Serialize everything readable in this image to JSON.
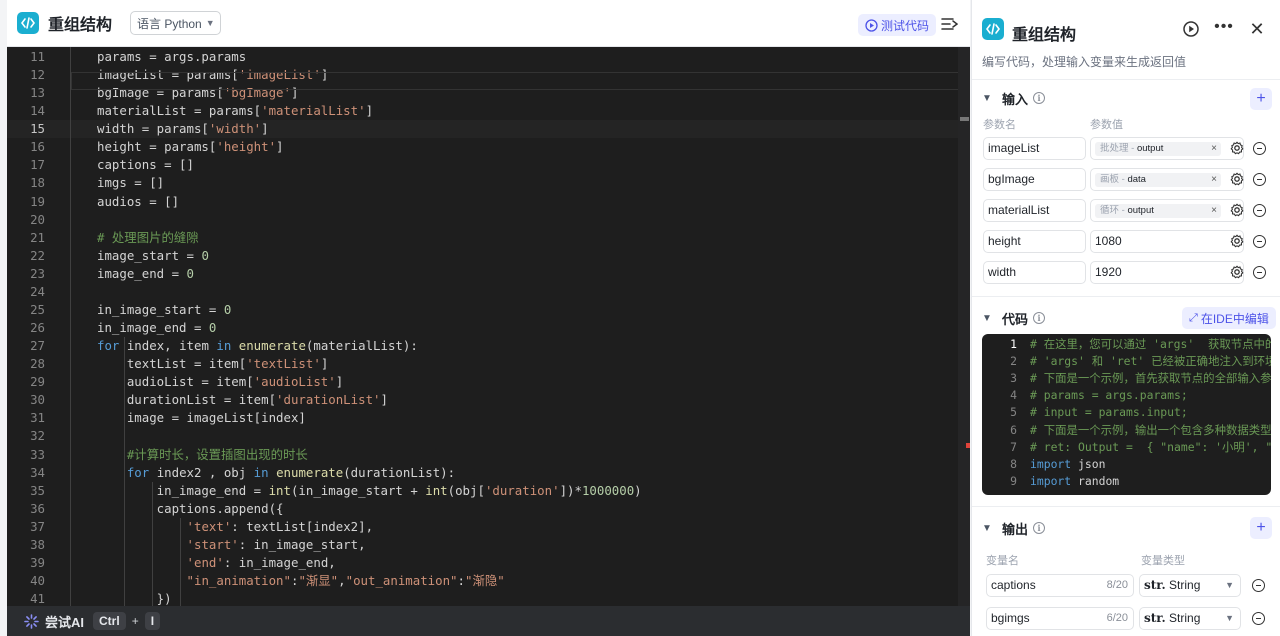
{
  "editor": {
    "title": "重组结构",
    "language_label": "语言 Python",
    "test_button": "测试代码",
    "ai_bar": {
      "label": "尝试AI",
      "key1": "Ctrl",
      "plus": "+",
      "key2": "I"
    },
    "lines": [
      {
        "n": "11",
        "code": "params = args.params"
      },
      {
        "n": "12",
        "code": "imageList = params['imageList']"
      },
      {
        "n": "13",
        "code": "bgImage = params['bgImage']"
      },
      {
        "n": "14",
        "code": "materialList = params['materialList']"
      },
      {
        "n": "15",
        "code": "width = params['width']"
      },
      {
        "n": "16",
        "code": "height = params['height']"
      },
      {
        "n": "17",
        "code": "captions = []"
      },
      {
        "n": "18",
        "code": "imgs = []"
      },
      {
        "n": "19",
        "code": "audios = []"
      },
      {
        "n": "20",
        "code": ""
      },
      {
        "n": "21",
        "code": "# 处理图片的缝隙"
      },
      {
        "n": "22",
        "code": "image_start = 0"
      },
      {
        "n": "23",
        "code": "image_end = 0"
      },
      {
        "n": "24",
        "code": ""
      },
      {
        "n": "25",
        "code": "in_image_start = 0"
      },
      {
        "n": "26",
        "code": "in_image_end = 0"
      },
      {
        "n": "27",
        "code": "for index, item in enumerate(materialList):"
      },
      {
        "n": "28",
        "code": "    textList = item['textList']"
      },
      {
        "n": "29",
        "code": "    audioList = item['audioList']"
      },
      {
        "n": "30",
        "code": "    durationList = item['durationList']"
      },
      {
        "n": "31",
        "code": "    image = imageList[index]"
      },
      {
        "n": "32",
        "code": ""
      },
      {
        "n": "33",
        "code": "    #计算时长，设置插图出现的时长"
      },
      {
        "n": "34",
        "code": "    for index2 , obj in enumerate(durationList):"
      },
      {
        "n": "35",
        "code": "        in_image_end = int(in_image_start + int(obj['duration'])*1000000)"
      },
      {
        "n": "36",
        "code": "        captions.append({"
      },
      {
        "n": "37",
        "code": "            'text': textList[index2],"
      },
      {
        "n": "38",
        "code": "            'start': in_image_start,"
      },
      {
        "n": "39",
        "code": "            'end': in_image_end,"
      },
      {
        "n": "40",
        "code": "            \"in_animation\":\"渐显\",\"out_animation\":\"渐隐\""
      },
      {
        "n": "41",
        "code": "        })"
      }
    ]
  },
  "panel": {
    "title": "重组结构",
    "description": "编写代码，处理输入变量来生成返回值",
    "input_section": {
      "title": "输入",
      "col_name": "参数名",
      "col_value": "参数值",
      "params": [
        {
          "name": "imageList",
          "ref_source": "批处理",
          "ref_field": "output"
        },
        {
          "name": "bgImage",
          "ref_source": "画板",
          "ref_field": "data"
        },
        {
          "name": "materialList",
          "ref_source": "循环",
          "ref_field": "output"
        },
        {
          "name": "height",
          "value": "1080"
        },
        {
          "name": "width",
          "value": "1920"
        }
      ]
    },
    "code_section": {
      "title": "代码",
      "ide_button": "在IDE中编辑",
      "lines": [
        {
          "n": "1",
          "code": "# 在这里，您可以通过 'args'  获取节点中的输入变量，并通过 'ret' 输出结果"
        },
        {
          "n": "2",
          "code": "# 'args' 和 'ret' 已经被正确地注入到环境中"
        },
        {
          "n": "3",
          "code": "# 下面是一个示例，首先获取节点的全部输入参数params"
        },
        {
          "n": "4",
          "code": "# params = args.params;"
        },
        {
          "n": "5",
          "code": "# input = params.input;"
        },
        {
          "n": "6",
          "code": "# 下面是一个示例，输出一个包含多种数据类型的 'ret' 对象"
        },
        {
          "n": "7",
          "code": "# ret: Output =  { \"name\": '小明', \"hobbies\": [\"看书\", \"旅游\"] };"
        },
        {
          "n": "8",
          "code": "import json"
        },
        {
          "n": "9",
          "code": "import random"
        }
      ]
    },
    "output_section": {
      "title": "输出",
      "col_name": "变量名",
      "col_type": "变量类型",
      "outputs": [
        {
          "name": "captions",
          "count": "8/20",
          "type_prefix": "str.",
          "type": "String"
        },
        {
          "name": "bgimgs",
          "count": "6/20",
          "type_prefix": "str.",
          "type": "String"
        }
      ]
    }
  },
  "colors": {
    "accent": "#4d53e8",
    "logo": "#1aaed0",
    "editor_bg": "#1e1e1e"
  }
}
